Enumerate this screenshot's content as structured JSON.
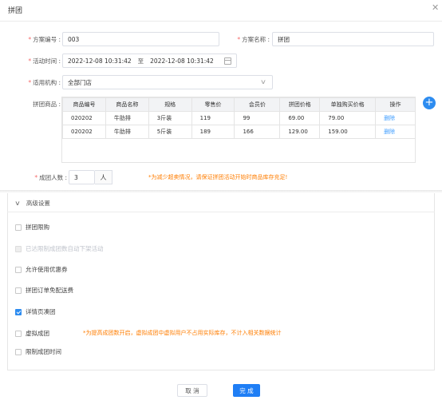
{
  "dialog": {
    "title": "拼团",
    "close_icon": "close-icon"
  },
  "form": {
    "plan_code": {
      "label": "方案编号 :",
      "value": "003"
    },
    "plan_name": {
      "label": "方案名称 :",
      "value": "拼团"
    },
    "activity_time": {
      "label": "活动时间 :",
      "start": "2022-12-08 10:31:42",
      "separator": "至",
      "end": "2022-12-08 10:31:42"
    },
    "institution": {
      "label": "适用机构 :",
      "value": "全部门店"
    },
    "goods": {
      "label": "拼团商品 :",
      "headers": [
        "商品编号",
        "商品名称",
        "规格",
        "零售价",
        "会员价",
        "拼团价格",
        "单独购买价格",
        "操作"
      ],
      "rows": [
        {
          "code": "020202",
          "name": "牛肋排",
          "spec": "3斤装",
          "retail": "119",
          "member": "99",
          "group_price": "69.00",
          "single_price": "79.00",
          "action": "删除"
        },
        {
          "code": "020202",
          "name": "牛肋排",
          "spec": "5斤装",
          "retail": "189",
          "member": "166",
          "group_price": "129.00",
          "single_price": "159.00",
          "action": "删除"
        }
      ],
      "add_button": "+"
    },
    "group_size": {
      "label": "成团人数 :",
      "value": "3",
      "unit": "人",
      "warning": "*为减少超卖情况，请保证拼团活动开始时商品库存充足!"
    }
  },
  "advanced": {
    "title": "高级设置",
    "options": [
      {
        "label": "拼团限购",
        "checked": false,
        "disabled": false
      },
      {
        "label": "已达限制成团数自动下架活动",
        "checked": false,
        "disabled": true
      },
      {
        "label": "允许使用优惠券",
        "checked": false,
        "disabled": false
      },
      {
        "label": "拼团订单免配送费",
        "checked": false,
        "disabled": false
      },
      {
        "label": "详情页凑团",
        "checked": true,
        "disabled": false
      },
      {
        "label": "虚拟成团",
        "checked": false,
        "disabled": false,
        "note": "*为提高成团数开启，虚拟成团中虚拟用户不占用实际库存，不计入相关数据统计"
      },
      {
        "label": "限制成团时间",
        "checked": false,
        "disabled": false
      }
    ]
  },
  "footer": {
    "cancel_label": "取 消",
    "done_label": "完 成"
  },
  "colors": {
    "primary": "#2d8cf0",
    "required": "#f56c6c",
    "warning": "#ff7d00"
  }
}
